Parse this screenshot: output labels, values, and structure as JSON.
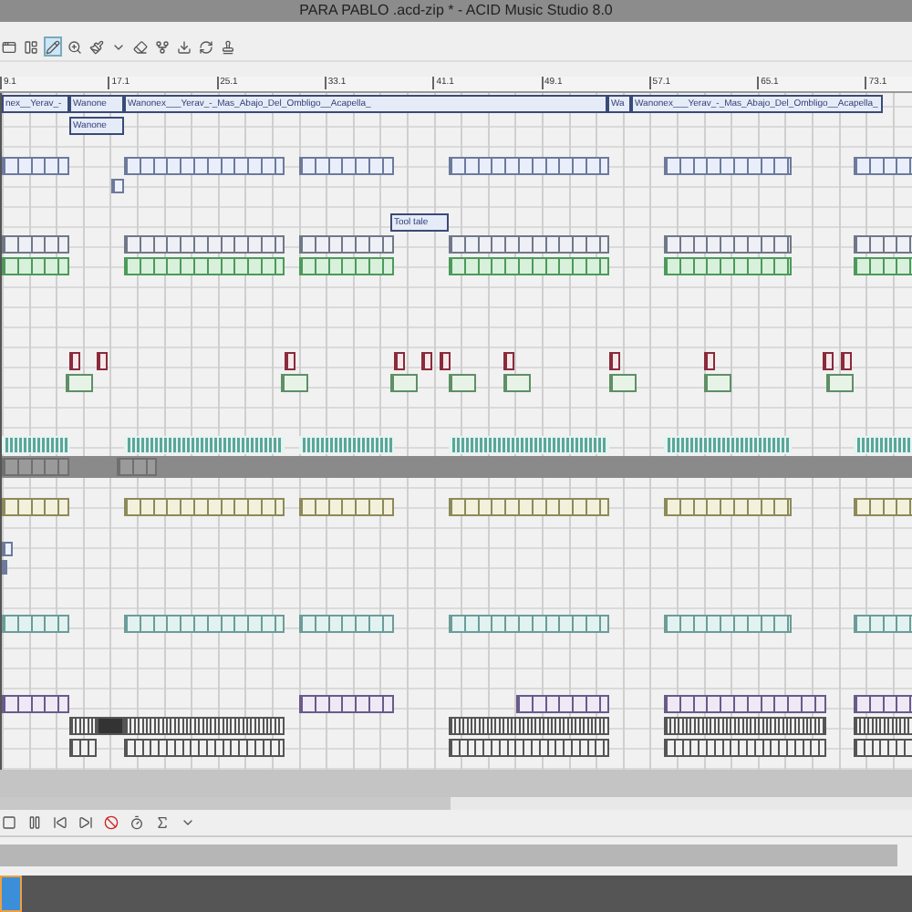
{
  "window": {
    "title": "PARA PABLO .acd-zip * - ACID Music Studio 8.0"
  },
  "toolbar": {
    "tools": [
      {
        "kind": "window",
        "selected": false
      },
      {
        "kind": "layout",
        "selected": false
      },
      {
        "kind": "draw",
        "selected": true
      },
      {
        "kind": "select",
        "selected": false
      },
      {
        "kind": "paint",
        "selected": false
      },
      {
        "kind": "dropdown",
        "selected": false
      },
      {
        "kind": "erase",
        "selected": false
      },
      {
        "kind": "envelope",
        "selected": false
      },
      {
        "kind": "download",
        "selected": false
      },
      {
        "kind": "loop",
        "selected": false
      },
      {
        "kind": "stamp",
        "selected": false
      }
    ]
  },
  "ruler": {
    "markers": [
      "9.1",
      "17.1",
      "25.1",
      "33.1",
      "41.1",
      "49.1",
      "57.1",
      "65.1",
      "73.1"
    ]
  },
  "tracks": [
    {
      "kind": "vocal",
      "clips": [
        {
          "label": "nex__Yerav_-"
        },
        {
          "label": "Wanone"
        },
        {
          "label": "Wanonex___Yerav_-_Mas_Abajo_Del_Ombligo__Acapella_"
        },
        {
          "label": "Wa"
        },
        {
          "label": "Wanonex___Yerav_-_Mas_Abajo_Del_Ombligo__Acapella_"
        }
      ]
    },
    {
      "kind": "vocal",
      "clips": [
        {
          "label": "Wanone"
        }
      ]
    },
    {
      "kind": "blue"
    },
    {
      "kind": "single"
    },
    {
      "kind": "vocal",
      "clips": [
        {
          "label": "Tool tale"
        }
      ]
    },
    {
      "kind": "tr"
    },
    {
      "kind": "green"
    },
    {
      "kind": "red"
    },
    {
      "kind": "greenhit"
    },
    {
      "kind": "teal"
    },
    {
      "kind": "band"
    },
    {
      "kind": "yellow"
    },
    {
      "kind": "single"
    },
    {
      "kind": "single"
    },
    {
      "kind": "cyan"
    },
    {
      "kind": "purple"
    },
    {
      "kind": "beat"
    },
    {
      "kind": "beat2"
    }
  ],
  "transport": {
    "buttons": [
      {
        "kind": "stop"
      },
      {
        "kind": "pause"
      },
      {
        "kind": "start"
      },
      {
        "kind": "end"
      },
      {
        "kind": "record"
      },
      {
        "kind": "metronome"
      },
      {
        "kind": "sigma"
      },
      {
        "kind": "dropdown"
      }
    ]
  }
}
